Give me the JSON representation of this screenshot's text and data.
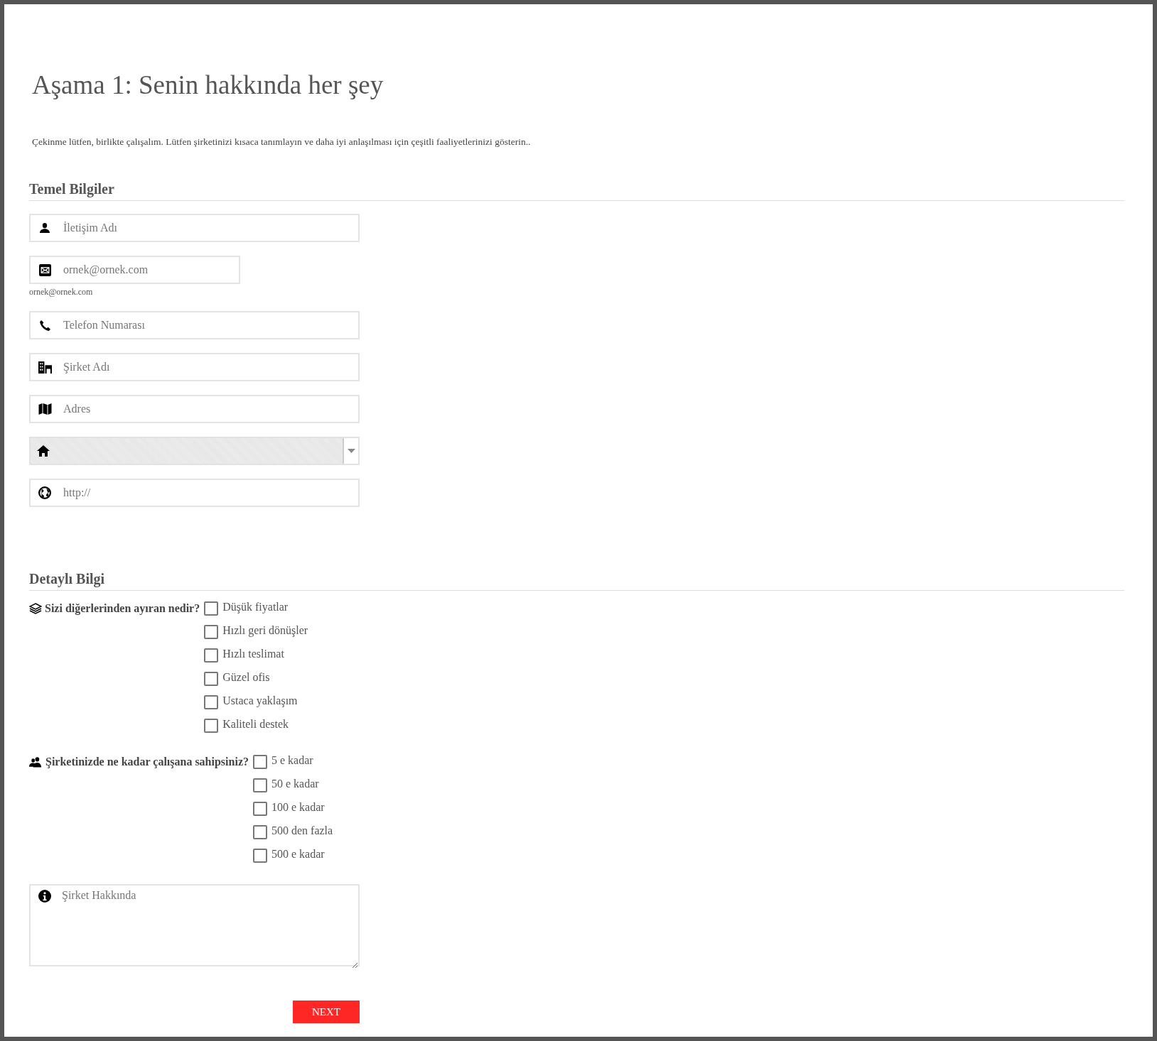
{
  "title": "Aşama 1: Senin hakkında her şey",
  "intro": "Çekinme lütfen, birlikte çalışalım. Lütfen şirketinizi kısaca tanımlayın ve daha iyi anlaşılması için çeşitli faaliyetlerinizi gösterin..",
  "basic": {
    "heading": "Temel Bilgiler",
    "fields": [
      {
        "kind": "input",
        "placeholder": "İletişim Adı"
      },
      {
        "kind": "input",
        "placeholder": "ornek@ornek.com",
        "hint": "ornek@ornek.com"
      },
      {
        "kind": "input",
        "placeholder": "Telefon Numarası"
      },
      {
        "kind": "input",
        "placeholder": "Şirket Adı"
      },
      {
        "kind": "input",
        "placeholder": "Adres"
      },
      {
        "kind": "select"
      },
      {
        "kind": "input",
        "placeholder": "http://"
      }
    ]
  },
  "detail": {
    "heading": "Detaylı Bilgi",
    "questions": [
      {
        "label": "Sizi diğerlerinden ayıran nedir?",
        "options": [
          {
            "label": "Düşük fiyatlar",
            "checked": false
          },
          {
            "label": "Hızlı geri dönüşler",
            "checked": false
          },
          {
            "label": "Hızlı teslimat",
            "checked": false
          },
          {
            "label": "Güzel ofis",
            "checked": false
          },
          {
            "label": "Ustaca yaklaşım",
            "checked": false
          },
          {
            "label": "Kaliteli destek",
            "checked": false
          }
        ]
      },
      {
        "label": "Şirketinizde ne kadar çalışana sahipsiniz?",
        "options": [
          {
            "label": "5 e kadar",
            "checked": false
          },
          {
            "label": "50 e kadar",
            "checked": false
          },
          {
            "label": "100 e kadar",
            "checked": false
          },
          {
            "label": "500 den fazla",
            "checked": false
          },
          {
            "label": "500 e kadar",
            "checked": false
          }
        ]
      }
    ],
    "about": {
      "placeholder": "Şirket Hakkında"
    }
  },
  "next_button": "NEXT"
}
